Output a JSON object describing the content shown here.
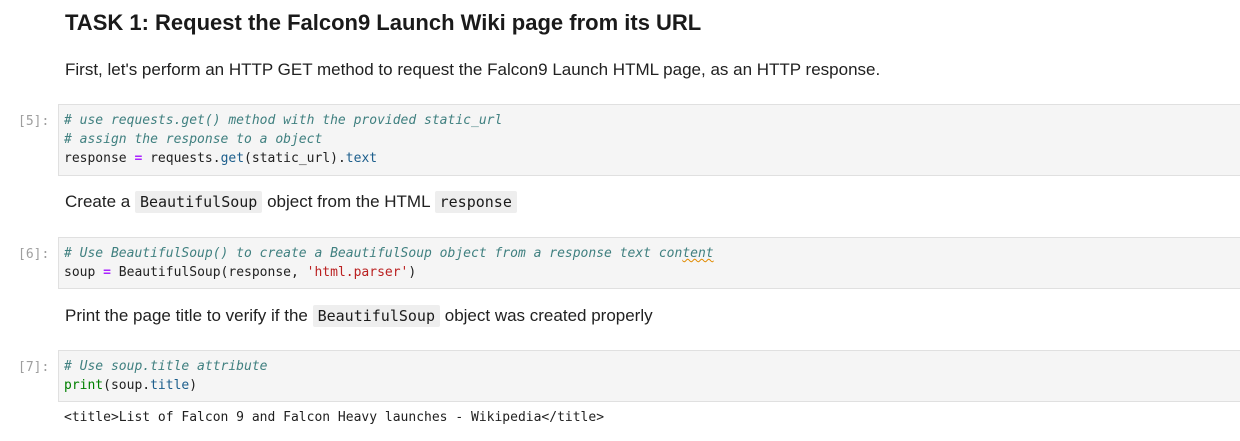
{
  "heading": "TASK 1: Request the Falcon9 Launch Wiki page from its URL",
  "intro": "First, let's perform an HTTP GET method to request the Falcon9 Launch HTML page, as an HTTP response.",
  "cell5": {
    "prompt": "[5]:",
    "comment1": "# use requests.get() method with the provided static_url",
    "comment2": "# assign the response to a object",
    "line3": {
      "var": "response",
      "op": "=",
      "obj": "requests.",
      "func": "get",
      "args": "(static_url).",
      "attr": "text"
    }
  },
  "md2": {
    "pre": "Create a",
    "code1": "BeautifulSoup",
    "mid": "object from the HTML",
    "code2": "response"
  },
  "cell6": {
    "prompt": "[6]:",
    "comment_main": "# Use BeautifulSoup() to create a BeautifulSoup object from a response text con",
    "comment_tail": "tent",
    "line2": {
      "var": "soup",
      "op": "=",
      "call": "BeautifulSoup(response, ",
      "str": "'html.parser'",
      "close": ")"
    }
  },
  "md3": {
    "pre": "Print the page title to verify if the",
    "code": "BeautifulSoup",
    "post": "object was created properly"
  },
  "cell7": {
    "prompt": "[7]:",
    "comment": "# Use soup.title attribute",
    "line2": {
      "builtin": "print",
      "open": "(soup.",
      "attr": "title",
      "close": ")"
    },
    "output": "<title>List of Falcon 9 and Falcon Heavy launches - Wikipedia</title>"
  }
}
